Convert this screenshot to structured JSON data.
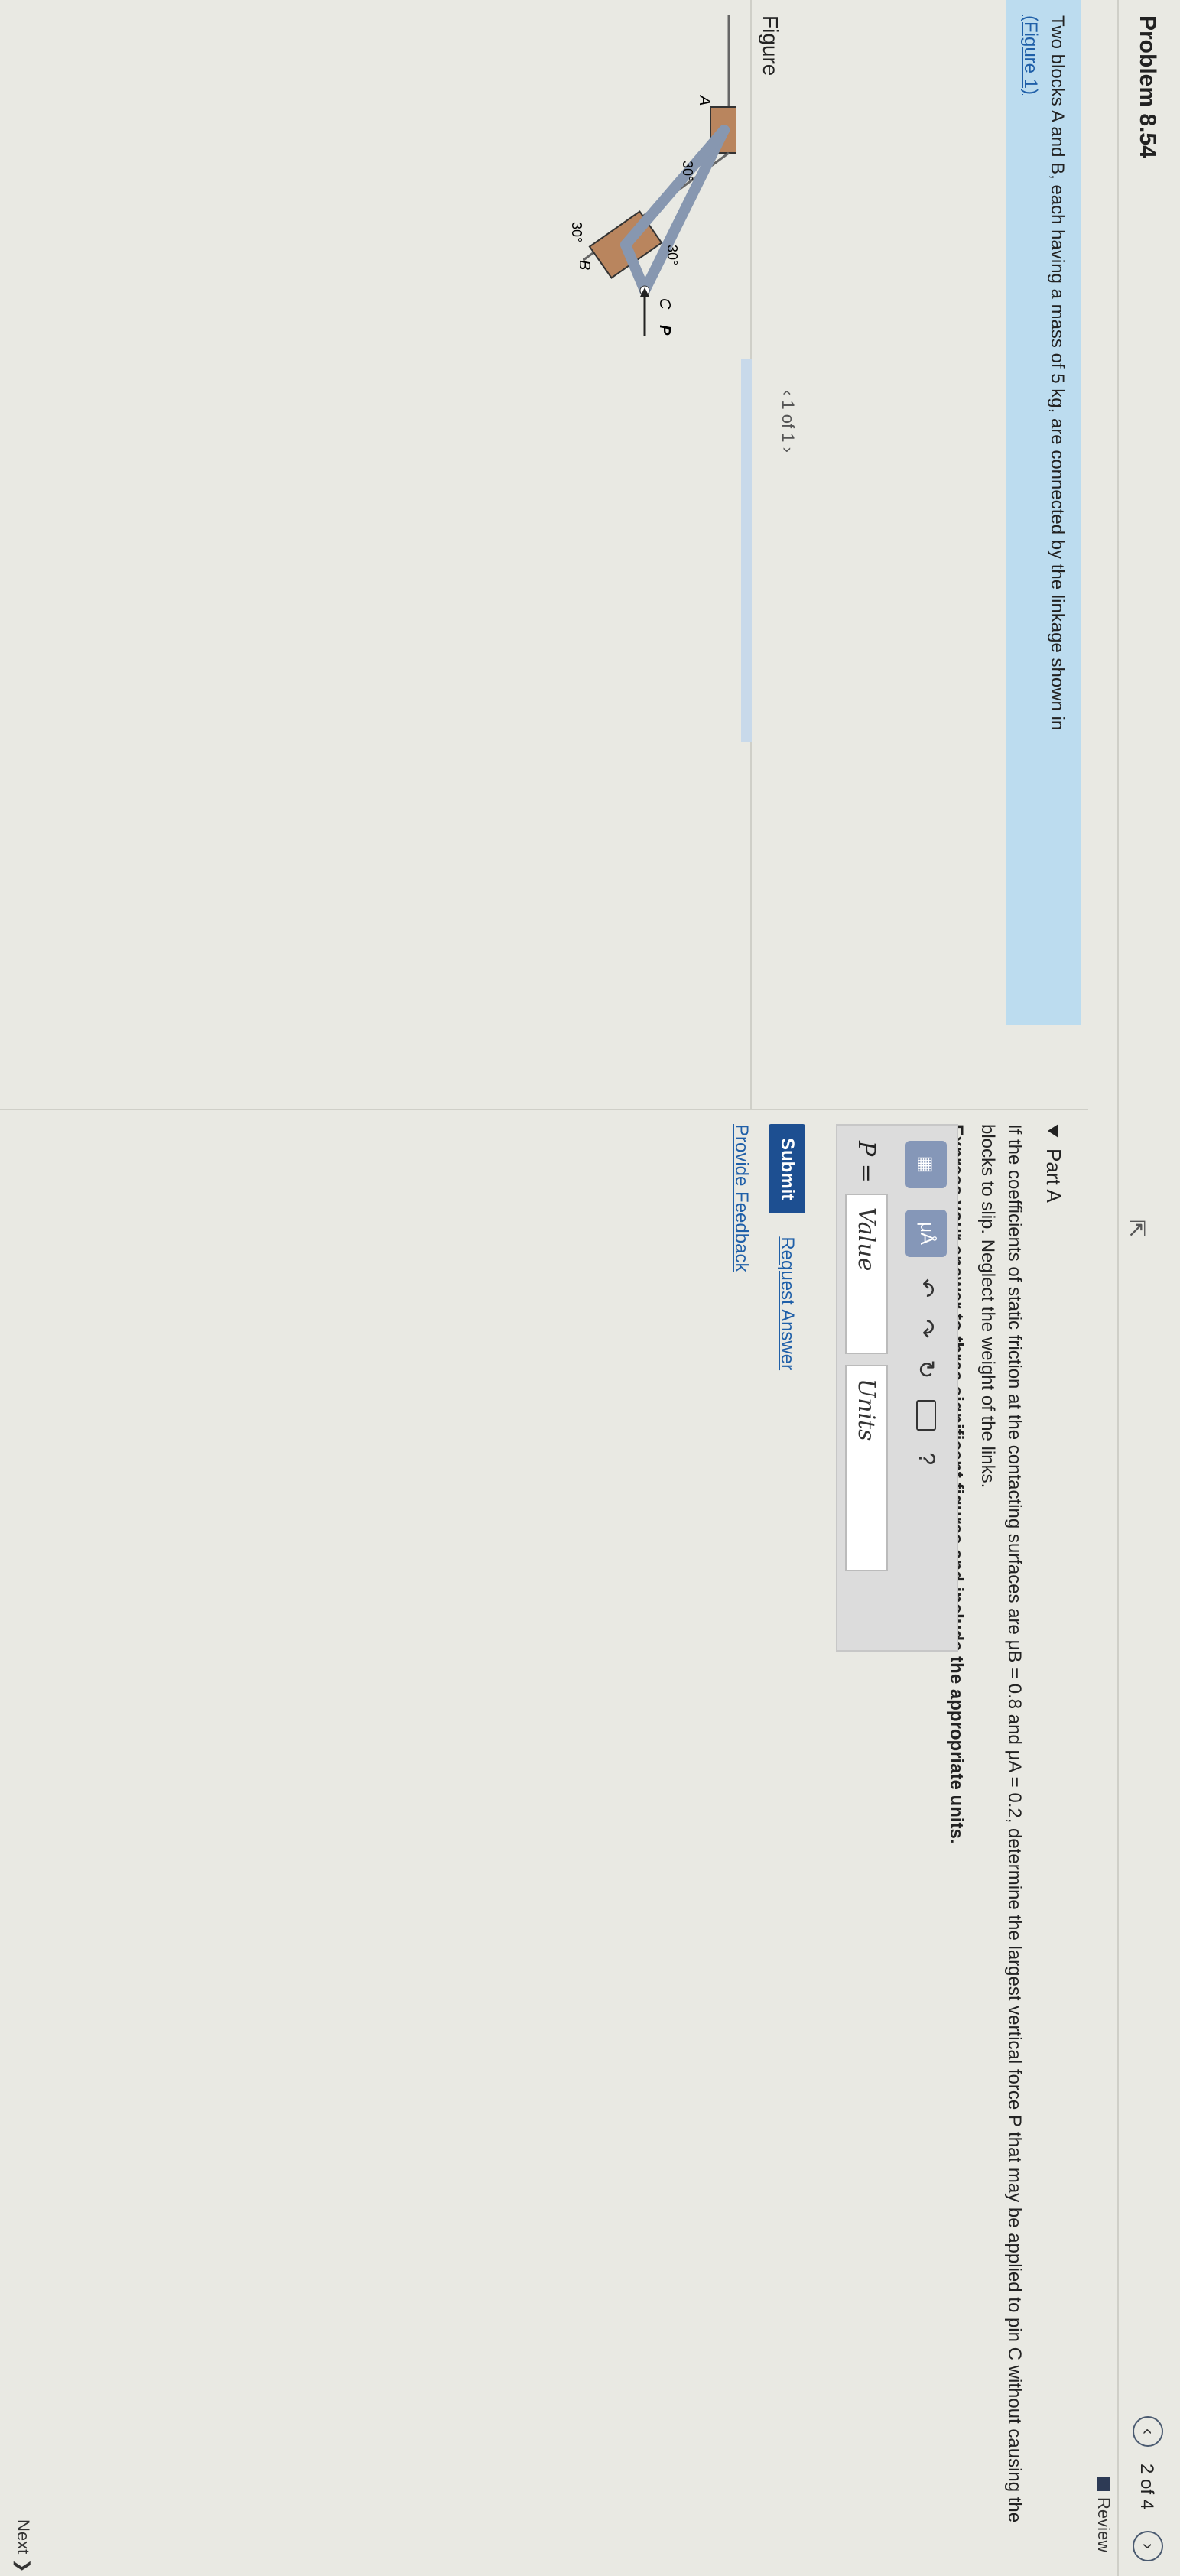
{
  "header": {
    "title": "Problem 8.54",
    "nav_count": "2 of 4",
    "prev_icon": "‹",
    "next_icon": "›",
    "review_label": "Review"
  },
  "problem": {
    "intro": "Two blocks A and B, each having a mass of 5 kg, are connected by the linkage shown in",
    "figure_link": "(Figure 1)"
  },
  "figure": {
    "label": "Figure",
    "pager": "‹  1 of 1  ›",
    "labels": {
      "A": "A",
      "B": "B",
      "C": "C",
      "P": "P",
      "angle_top": "30°",
      "angle_mid": "30°",
      "angle_bottom": "30°"
    }
  },
  "part_a": {
    "title": "Part A",
    "question": "If the coefficients of static friction at the contacting surfaces are μB = 0.8 and μA = 0.2, determine the largest vertical force P that may be applied to pin C without causing the blocks to slip. Neglect the weight of the links.",
    "instruction": "Express your answer to three significant figures and include the appropriate units.",
    "toolbar": {
      "templates_icon": "templates-icon",
      "mu_label": "μÅ",
      "undo": "↶",
      "redo": "↷",
      "reset": "↻",
      "help": "?"
    },
    "answer_label": "P =",
    "value_placeholder": "Value",
    "units_placeholder": "Units",
    "submit_label": "Submit",
    "request_label": "Request Answer",
    "feedback_label": "Provide Feedback"
  },
  "footer": {
    "next_label": "Next ❯"
  }
}
